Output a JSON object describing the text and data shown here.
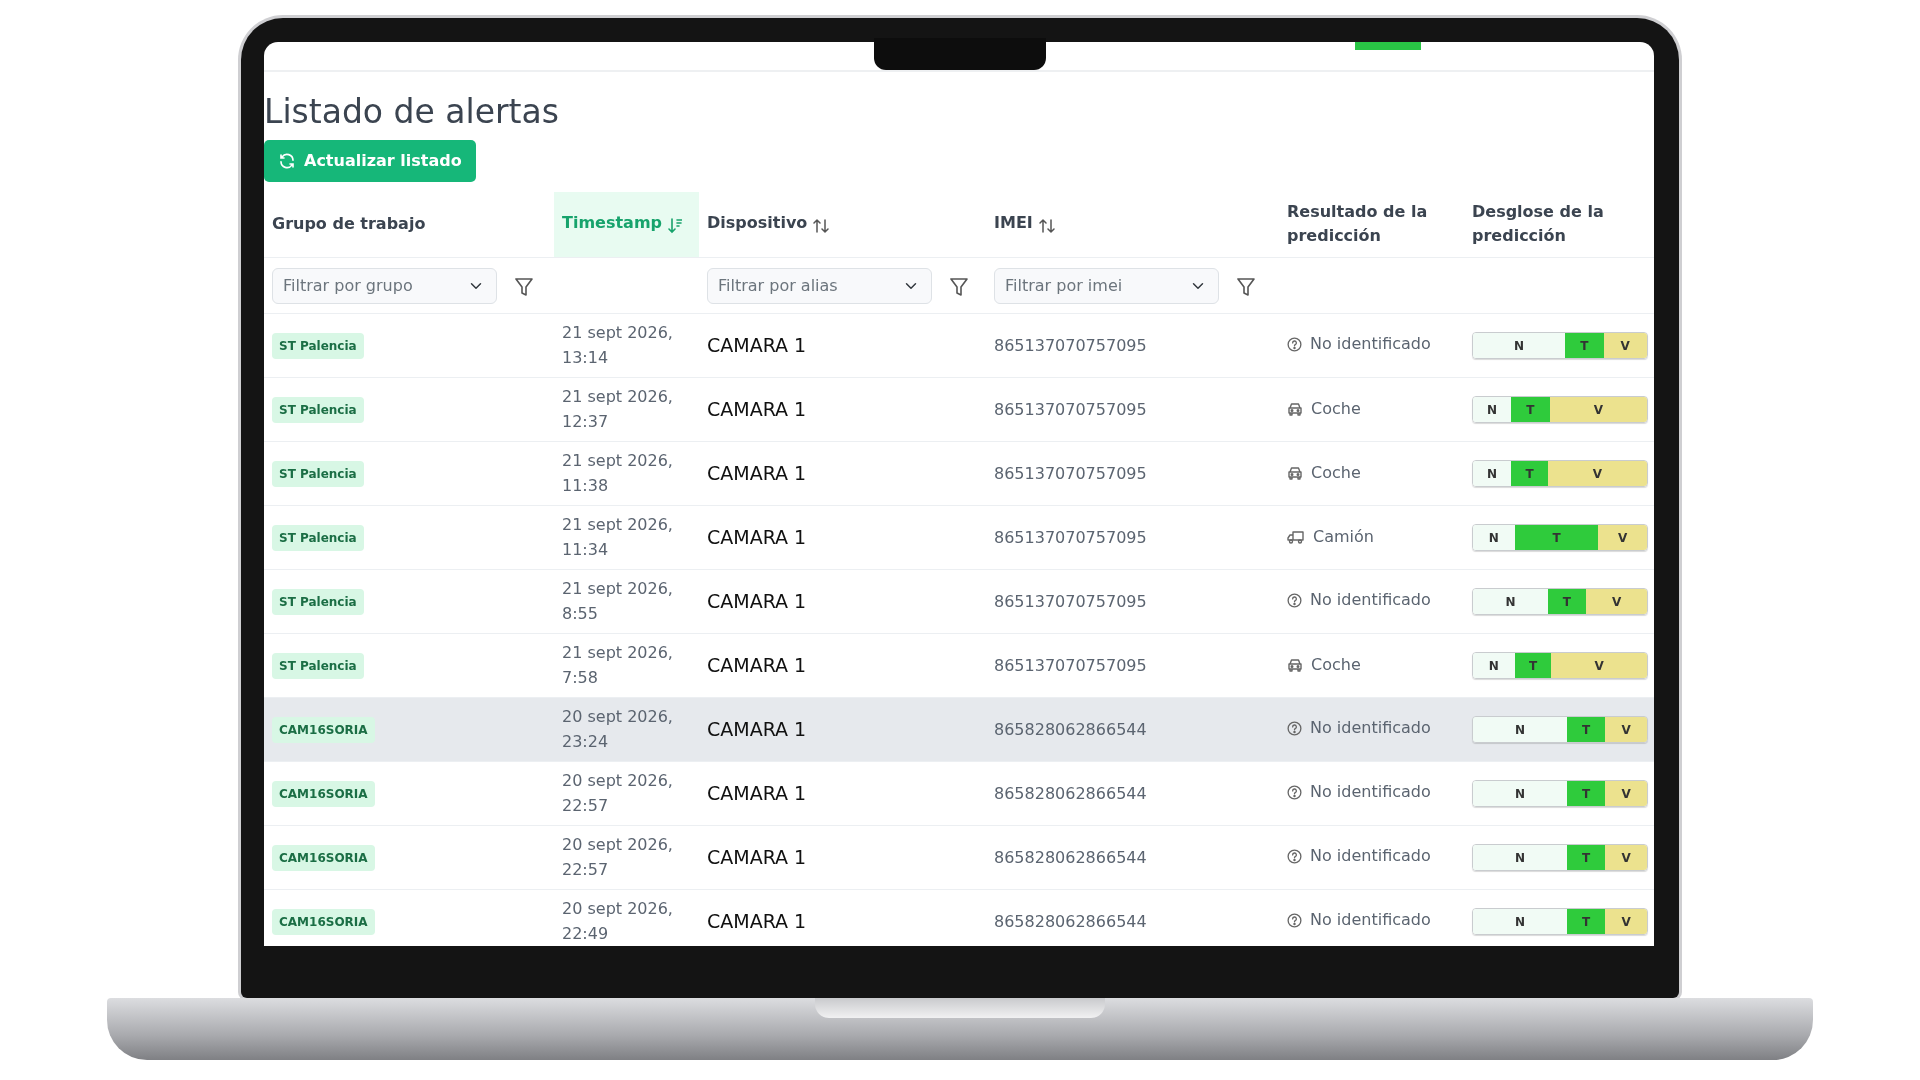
{
  "page": {
    "title": "Listado de alertas",
    "refresh_button": "Actualizar listado"
  },
  "columns": [
    {
      "label": "Grupo de trabajo",
      "sortable": false,
      "sorted": false,
      "filter_placeholder": "Filtrar por grupo"
    },
    {
      "label": "Timestamp",
      "sortable": true,
      "sorted": true
    },
    {
      "label": "Dispositivo",
      "sortable": true,
      "sorted": false,
      "filter_placeholder": "Filtrar por alias"
    },
    {
      "label": "IMEI",
      "sortable": true,
      "sorted": false,
      "filter_placeholder": "Filtrar por imei"
    },
    {
      "label": "Resultado de la predicción",
      "sortable": false,
      "sorted": false
    },
    {
      "label": "Desglose de la predicción",
      "sortable": false,
      "sorted": false
    }
  ],
  "rows": [
    {
      "group": "ST Palencia",
      "timestamp": "21 sept 2026, 13:14",
      "device": "CAMARA 1",
      "imei": "865137070757095",
      "result": {
        "kind": "unknown",
        "label": "No identificado"
      },
      "hovered": false,
      "breakdown": [
        {
          "label": "N",
          "level": 0.53
        },
        {
          "label": "T"
        },
        {
          "label": "V",
          "level": 0.25
        }
      ]
    },
    {
      "group": "ST Palencia",
      "timestamp": "21 sept 2026, 12:37",
      "device": "CAMARA 1",
      "imei": "865137070757095",
      "result": {
        "kind": "car",
        "label": "Coche"
      },
      "hovered": false,
      "breakdown": [
        {
          "label": "N",
          "level": 0.22
        },
        {
          "label": "T"
        },
        {
          "label": "V",
          "level": 0.56
        }
      ]
    },
    {
      "group": "ST Palencia",
      "timestamp": "21 sept 2026, 11:38",
      "device": "CAMARA 1",
      "imei": "865137070757095",
      "result": {
        "kind": "car",
        "label": "Coche"
      },
      "hovered": false,
      "breakdown": [
        {
          "label": "N",
          "level": 0.22
        },
        {
          "label": "T"
        },
        {
          "label": "V",
          "level": 0.57
        }
      ]
    },
    {
      "group": "ST Palencia",
      "timestamp": "21 sept 2026, 11:34",
      "device": "CAMARA 1",
      "imei": "865137070757095",
      "result": {
        "kind": "truck",
        "label": "Camión"
      },
      "hovered": false,
      "breakdown": [
        {
          "label": "N",
          "level": 0.24
        },
        {
          "label": "T"
        },
        {
          "label": "V",
          "level": 0.28
        }
      ]
    },
    {
      "group": "ST Palencia",
      "timestamp": "21 sept 2026, 8:55",
      "device": "CAMARA 1",
      "imei": "865137070757095",
      "result": {
        "kind": "unknown",
        "label": "No identificado"
      },
      "hovered": false,
      "breakdown": [
        {
          "label": "N",
          "level": 0.43
        },
        {
          "label": "T"
        },
        {
          "label": "V",
          "level": 0.35
        }
      ]
    },
    {
      "group": "ST Palencia",
      "timestamp": "21 sept 2026, 7:58",
      "device": "CAMARA 1",
      "imei": "865137070757095",
      "result": {
        "kind": "car",
        "label": "Coche"
      },
      "hovered": false,
      "breakdown": [
        {
          "label": "N",
          "level": 0.24
        },
        {
          "label": "T"
        },
        {
          "label": "V",
          "level": 0.55
        }
      ]
    },
    {
      "group": "CAM16SORIA",
      "timestamp": "20 sept 2026, 23:24",
      "device": "CAMARA 1",
      "imei": "865828062866544",
      "result": {
        "kind": "unknown",
        "label": "No identificado"
      },
      "hovered": true,
      "breakdown": [
        {
          "label": "N",
          "level": 0.54
        },
        {
          "label": "T"
        },
        {
          "label": "V",
          "level": 0.24
        }
      ]
    },
    {
      "group": "CAM16SORIA",
      "timestamp": "20 sept 2026, 22:57",
      "device": "CAMARA 1",
      "imei": "865828062866544",
      "result": {
        "kind": "unknown",
        "label": "No identificado"
      },
      "hovered": false,
      "breakdown": [
        {
          "label": "N",
          "level": 0.54
        },
        {
          "label": "T"
        },
        {
          "label": "V",
          "level": 0.24
        }
      ]
    },
    {
      "group": "CAM16SORIA",
      "timestamp": "20 sept 2026, 22:57",
      "device": "CAMARA 1",
      "imei": "865828062866544",
      "result": {
        "kind": "unknown",
        "label": "No identificado"
      },
      "hovered": false,
      "breakdown": [
        {
          "label": "N",
          "level": 0.54
        },
        {
          "label": "T"
        },
        {
          "label": "V",
          "level": 0.24
        }
      ]
    },
    {
      "group": "CAM16SORIA",
      "timestamp": "20 sept 2026, 22:49",
      "device": "CAMARA 1",
      "imei": "865828062866544",
      "result": {
        "kind": "unknown",
        "label": "No identificado"
      },
      "hovered": false,
      "breakdown": [
        {
          "label": "N",
          "level": 0.54
        },
        {
          "label": "T"
        },
        {
          "label": "V",
          "level": 0.24
        }
      ]
    }
  ]
}
